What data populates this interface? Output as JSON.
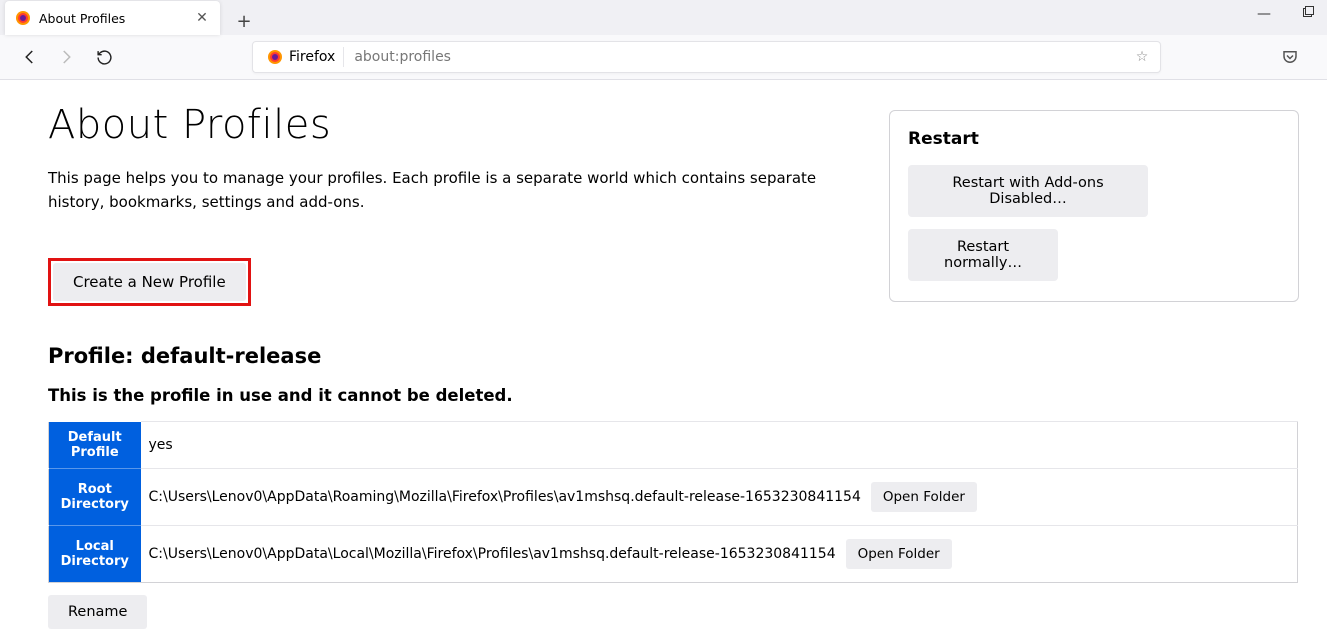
{
  "tabstrip": {
    "tab_title": "About Profiles"
  },
  "toolbar": {
    "identity_label": "Firefox",
    "url": "about:profiles"
  },
  "page": {
    "title": "About Profiles",
    "intro": "This page helps you to manage your profiles. Each profile is a separate world which contains separate history, bookmarks, settings and add-ons.",
    "create_button": "Create a New Profile"
  },
  "restart": {
    "heading": "Restart",
    "disabled": "Restart with Add-ons Disabled…",
    "normal": "Restart normally…"
  },
  "profile": {
    "heading": "Profile: default-release",
    "in_use_note": "This is the profile in use and it cannot be deleted.",
    "rows": {
      "default_label": "Default Profile",
      "default_value": "yes",
      "root_label": "Root Directory",
      "root_value": "C:\\Users\\Lenov0\\AppData\\Roaming\\Mozilla\\Firefox\\Profiles\\av1mshsq.default-release-1653230841154",
      "local_label": "Local Directory",
      "local_value": "C:\\Users\\Lenov0\\AppData\\Local\\Mozilla\\Firefox\\Profiles\\av1mshsq.default-release-1653230841154",
      "open_folder": "Open Folder"
    },
    "rename": "Rename"
  }
}
